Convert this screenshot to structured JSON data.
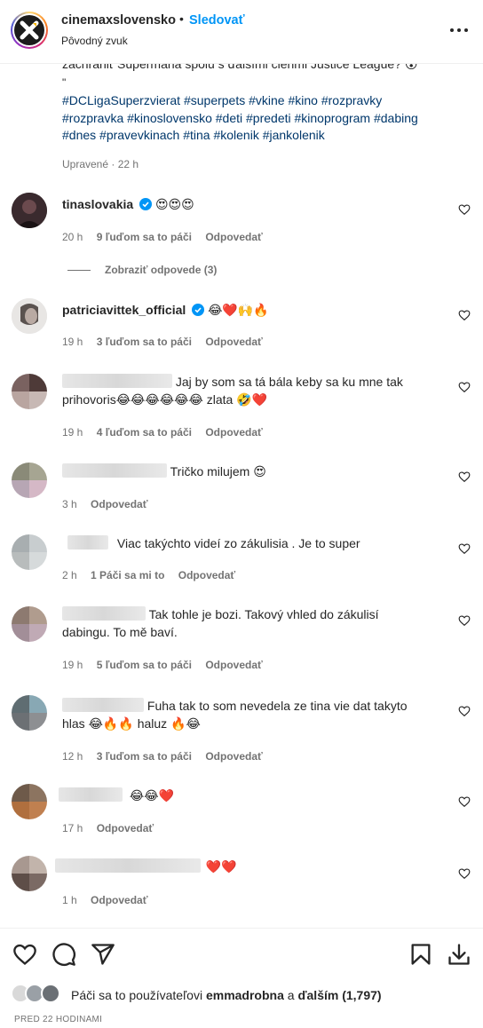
{
  "header": {
    "username": "cinemaxslovensko",
    "dot": "•",
    "follow_label": "Sledovať",
    "audio_label": "Pôvodný zvuk",
    "more_icon": "more-horizontal-icon"
  },
  "caption": {
    "cut_line": "zachrániť Supermana spolu s ďalšími členmi Justice League? 😮",
    "quote_mark": "\"",
    "hashtags": "#DCLigaSuperzvierat #superpets #vkine #kino #rozpravky #rozpravka #kinoslovensko #deti #predeti #kinoprogram #dabing #dnes #pravevkinach #tina #kolenik #jankolenik",
    "edited": "Upravené · 22 h"
  },
  "comments": [
    {
      "username": "tinaslovakia",
      "verified": true,
      "text": "",
      "emojis": [
        "heart-eyes",
        "heart-eyes",
        "heart-eyes"
      ],
      "time": "20 h",
      "likes": "9 ľuďom sa to páči",
      "reply": "Odpovedať",
      "view_replies": "Zobraziť odpovede (3)"
    },
    {
      "username": "patriciavittek_official",
      "verified": true,
      "text": "",
      "emojis": [
        "laugh",
        "red-heart",
        "raising-hands",
        "fire"
      ],
      "time": "19 h",
      "likes": "3 ľuďom sa to páči",
      "reply": "Odpovedať"
    },
    {
      "username_hint": "",
      "text_line1": "Jaj by som sa tá bála keby sa ku mne tak",
      "text_line2a": "prihovoris",
      "text_line2b": "zlata",
      "time": "19 h",
      "likes": "4 ľuďom sa to páči",
      "reply": "Odpovedať"
    },
    {
      "text": "Tričko milujem",
      "time": "3 h",
      "reply": "Odpovedať"
    },
    {
      "text": "Viac takýchto videí zo zákulisia . Je to super",
      "time": "2 h",
      "likes": "1 Páči sa mi to",
      "reply": "Odpovedať"
    },
    {
      "text_line1": "Tak tohle je bozi. Takový vhled do zákulisí",
      "text_line2": "dabingu. To mě baví.",
      "time": "19 h",
      "likes": "5 ľuďom sa to páči",
      "reply": "Odpovedať"
    },
    {
      "text_line1": "Fuha tak to som nevedela ze tina vie dat takyto",
      "text_line2a": "hlas",
      "text_line2b": "haluz",
      "time": "12 h",
      "likes": "3 ľuďom sa to páči",
      "reply": "Odpovedať"
    },
    {
      "text": "",
      "time": "17 h",
      "reply": "Odpovedať"
    },
    {
      "text": "",
      "time": "1 h",
      "reply": "Odpovedať"
    }
  ],
  "actions": {
    "like_icon": "heart-icon",
    "comment_icon": "comment-icon",
    "share_icon": "send-icon",
    "save_icon": "bookmark-icon",
    "download_icon": "download-icon"
  },
  "likes_summary": {
    "prefix": "Páči sa to používateľovi",
    "user": "emmadrobna",
    "middle": "a",
    "others": "ďalším (1,797)"
  },
  "timestamp": "PRED 22 HODINAMI",
  "colors": {
    "link": "#0095f6",
    "hashtag": "#00376b",
    "muted": "#737373",
    "heart": "#e0245e"
  }
}
